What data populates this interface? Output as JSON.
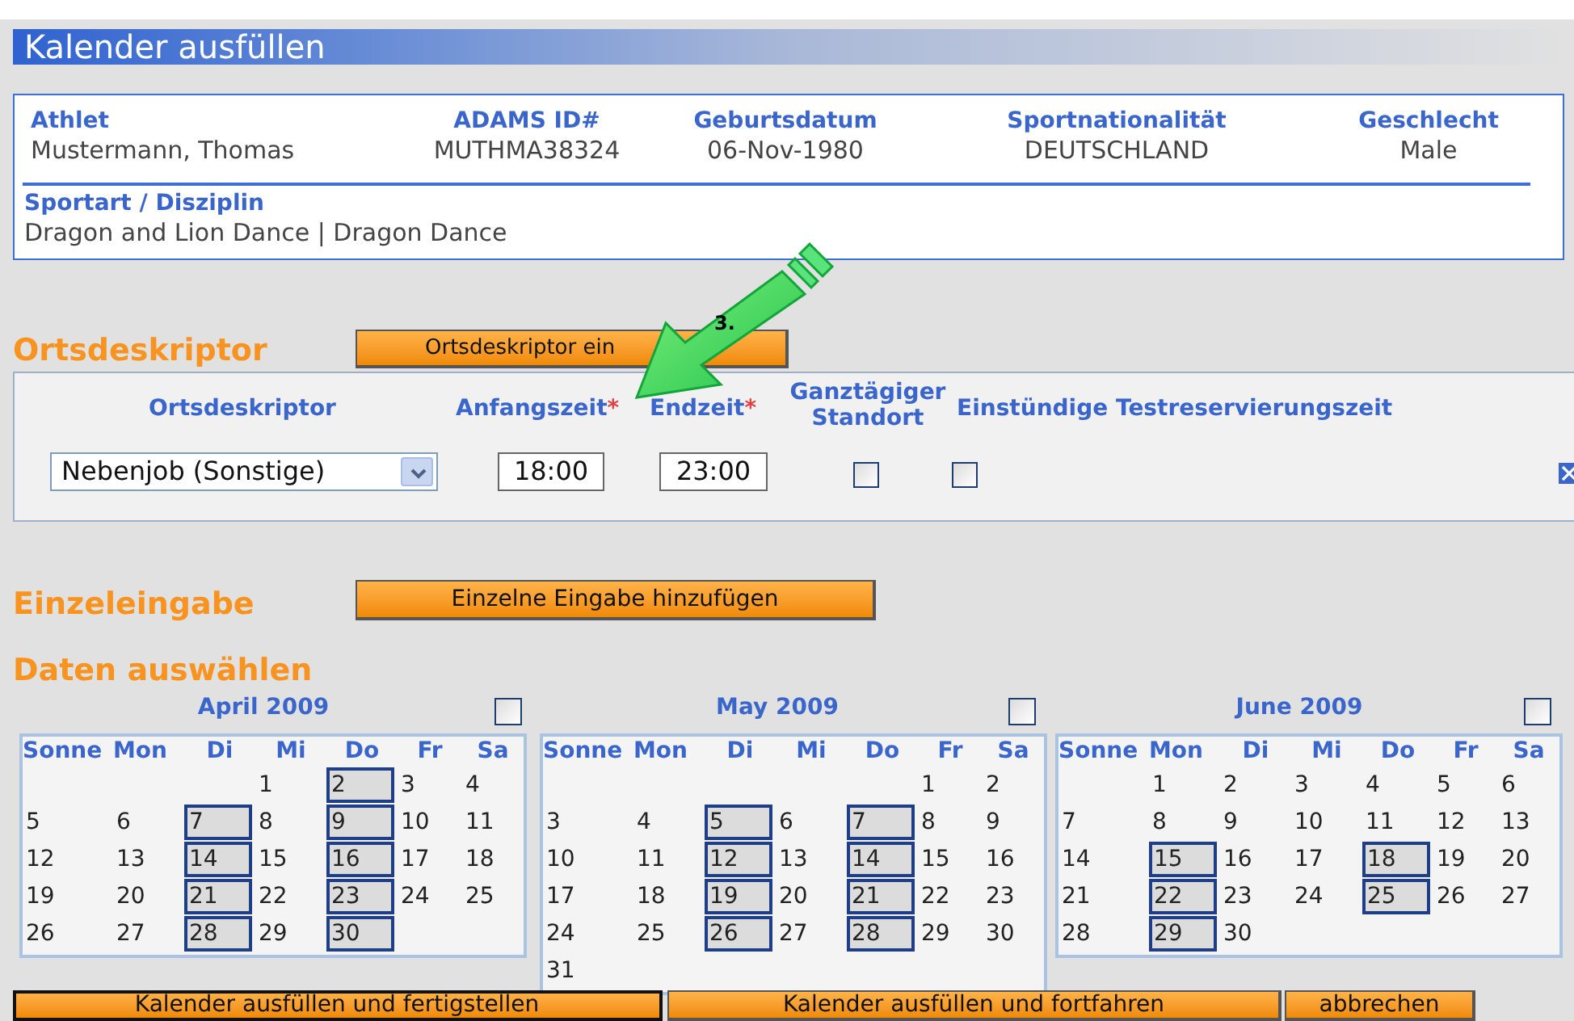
{
  "title": "Kalender ausfüllen",
  "athlete": {
    "fields": [
      {
        "label": "Athlet",
        "value": "Mustermann, Thomas"
      },
      {
        "label": "ADAMS ID#",
        "value": "MUTHMA38324"
      },
      {
        "label": "Geburtsdatum",
        "value": "06-Nov-1980"
      },
      {
        "label": "Sportnationalität",
        "value": "DEUTSCHLAND"
      },
      {
        "label": "Geschlecht",
        "value": "Male"
      }
    ],
    "sport": {
      "label": "Sportart / Disziplin",
      "value": "Dragon and Lion Dance | Dragon Dance"
    }
  },
  "location_section": {
    "heading": "Ortsdeskriptor",
    "button": "Ortsdeskriptor ein",
    "columns": [
      {
        "label": "Ortsdeskriptor"
      },
      {
        "label": "Anfangszeit",
        "required_mark": "*"
      },
      {
        "label": "Endzeit",
        "required_mark": "*"
      },
      {
        "label": "Ganztägiger Standort"
      },
      {
        "label": "Einstündige Testreservierungszeit"
      }
    ],
    "rows": [
      {
        "descriptor": "Nebenjob (Sonstige)",
        "start": "18:00",
        "end": "23:00",
        "all_day": false,
        "one_hour_slot": false
      }
    ]
  },
  "annotation": {
    "label": "3."
  },
  "single_entry": {
    "heading": "Einzeleingabe",
    "button": "Einzelne Eingabe hinzufügen"
  },
  "dates": {
    "heading": "Daten auswählen",
    "months": [
      {
        "title": "April 2009",
        "checked": false,
        "weekdays": [
          "Sonne",
          "Mon",
          "Di",
          "Mi",
          "Do",
          "Fr",
          "Sa"
        ],
        "weeks": [
          [
            {
              "day": "1",
              "selected": false
            },
            {
              "day": "2",
              "selected": true
            },
            {
              "day": "3",
              "selected": false
            },
            {
              "day": "4",
              "selected": false
            }
          ],
          [
            {
              "day": "5",
              "selected": false
            },
            {
              "day": "6",
              "selected": false
            },
            {
              "day": "7",
              "selected": true
            },
            {
              "day": "8",
              "selected": false
            },
            {
              "day": "9",
              "selected": true
            },
            {
              "day": "10",
              "selected": false
            },
            {
              "day": "11",
              "selected": false
            }
          ],
          [
            {
              "day": "12",
              "selected": false
            },
            {
              "day": "13",
              "selected": false
            },
            {
              "day": "14",
              "selected": true
            },
            {
              "day": "15",
              "selected": false
            },
            {
              "day": "16",
              "selected": true
            },
            {
              "day": "17",
              "selected": false
            },
            {
              "day": "18",
              "selected": false
            }
          ],
          [
            {
              "day": "19",
              "selected": false
            },
            {
              "day": "20",
              "selected": false
            },
            {
              "day": "21",
              "selected": true
            },
            {
              "day": "22",
              "selected": false
            },
            {
              "day": "23",
              "selected": true
            },
            {
              "day": "24",
              "selected": false
            },
            {
              "day": "25",
              "selected": false
            }
          ],
          [
            {
              "day": "26",
              "selected": false
            },
            {
              "day": "27",
              "selected": false
            },
            {
              "day": "28",
              "selected": true
            },
            {
              "day": "29",
              "selected": false
            },
            {
              "day": "30",
              "selected": true
            }
          ]
        ]
      },
      {
        "title": "May 2009",
        "checked": false,
        "weekdays": [
          "Sonne",
          "Mon",
          "Di",
          "Mi",
          "Do",
          "Fr",
          "Sa"
        ],
        "weeks": [
          [
            {
              "day": "1",
              "selected": false
            },
            {
              "day": "2",
              "selected": false
            }
          ],
          [
            {
              "day": "3",
              "selected": false
            },
            {
              "day": "4",
              "selected": false
            },
            {
              "day": "5",
              "selected": true
            },
            {
              "day": "6",
              "selected": false
            },
            {
              "day": "7",
              "selected": true
            },
            {
              "day": "8",
              "selected": false
            },
            {
              "day": "9",
              "selected": false
            }
          ],
          [
            {
              "day": "10",
              "selected": false
            },
            {
              "day": "11",
              "selected": false
            },
            {
              "day": "12",
              "selected": true
            },
            {
              "day": "13",
              "selected": false
            },
            {
              "day": "14",
              "selected": true
            },
            {
              "day": "15",
              "selected": false
            },
            {
              "day": "16",
              "selected": false
            }
          ],
          [
            {
              "day": "17",
              "selected": false
            },
            {
              "day": "18",
              "selected": false
            },
            {
              "day": "19",
              "selected": true
            },
            {
              "day": "20",
              "selected": false
            },
            {
              "day": "21",
              "selected": true
            },
            {
              "day": "22",
              "selected": false
            },
            {
              "day": "23",
              "selected": false
            }
          ],
          [
            {
              "day": "24",
              "selected": false
            },
            {
              "day": "25",
              "selected": false
            },
            {
              "day": "26",
              "selected": true
            },
            {
              "day": "27",
              "selected": false
            },
            {
              "day": "28",
              "selected": true
            },
            {
              "day": "29",
              "selected": false
            },
            {
              "day": "30",
              "selected": false
            }
          ],
          [
            {
              "day": "31",
              "selected": false
            }
          ]
        ]
      },
      {
        "title": "June 2009",
        "checked": false,
        "weekdays": [
          "Sonne",
          "Mon",
          "Di",
          "Mi",
          "Do",
          "Fr",
          "Sa"
        ],
        "weeks": [
          [
            {
              "day": "1",
              "selected": false
            },
            {
              "day": "2",
              "selected": false
            },
            {
              "day": "3",
              "selected": false
            },
            {
              "day": "4",
              "selected": false
            },
            {
              "day": "5",
              "selected": false
            },
            {
              "day": "6",
              "selected": false
            }
          ],
          [
            {
              "day": "7",
              "selected": false
            },
            {
              "day": "8",
              "selected": false
            },
            {
              "day": "9",
              "selected": false
            },
            {
              "day": "10",
              "selected": false
            },
            {
              "day": "11",
              "selected": false
            },
            {
              "day": "12",
              "selected": false
            },
            {
              "day": "13",
              "selected": false
            }
          ],
          [
            {
              "day": "14",
              "selected": false
            },
            {
              "day": "15",
              "selected": true
            },
            {
              "day": "16",
              "selected": false
            },
            {
              "day": "17",
              "selected": false
            },
            {
              "day": "18",
              "selected": true
            },
            {
              "day": "19",
              "selected": false
            },
            {
              "day": "20",
              "selected": false
            }
          ],
          [
            {
              "day": "21",
              "selected": false
            },
            {
              "day": "22",
              "selected": true
            },
            {
              "day": "23",
              "selected": false
            },
            {
              "day": "24",
              "selected": false
            },
            {
              "day": "25",
              "selected": true
            },
            {
              "day": "26",
              "selected": false
            },
            {
              "day": "27",
              "selected": false
            }
          ],
          [
            {
              "day": "28",
              "selected": false
            },
            {
              "day": "29",
              "selected": true
            },
            {
              "day": "30",
              "selected": false
            }
          ]
        ]
      }
    ]
  },
  "buttons": [
    {
      "label": "Kalender ausfüllen und fertigstellen",
      "focused": true
    },
    {
      "label": "Kalender ausfüllen und fortfahren",
      "focused": false
    },
    {
      "label": "abbrechen",
      "focused": false
    }
  ]
}
